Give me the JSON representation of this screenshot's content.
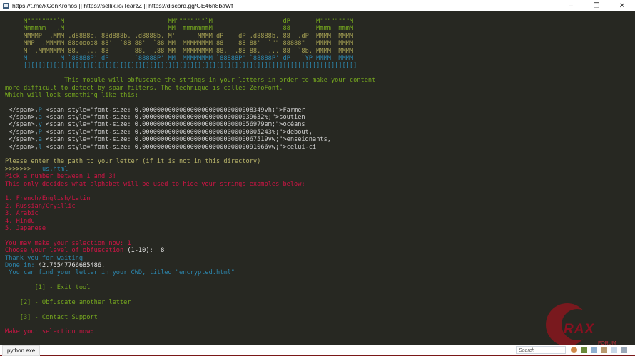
{
  "window": {
    "title": "https://t.me/xConKronos || https://sellix.io/TearzZ || https://discord.gg/GE46n8baWf",
    "minimize": "–",
    "restore": "❐",
    "close": "✕"
  },
  "terminal": {
    "lines": [
      [
        {
          "t": "     M\"\"\"\"\"\"\"\"`M                            MM\"\"\"\"\"\"\"\"`M                   dP       M\"\"\"\"\"\"\"\"M",
          "c": "green"
        }
      ],
      [
        {
          "t": "     Mmmmmm   .M                            MM  mmmmmmmM                   88       Mmmm  mmmM",
          "c": "green"
        }
      ],
      [
        {
          "t": "     MMMMP  .MMM .d8888b. 88d888b. .d8888b. M'      MMMM dP    dP .d8888b. 88  .dP  MMMM  MMMM",
          "c": "olive"
        }
      ],
      [
        {
          "t": "     MMP  .MMMMM 88ooood8 88'  `88 88'  `88 MM  MMMMMMMM 88    88 88'  `\"\" 88888\"   MMMM  MMMM",
          "c": "olive"
        }
      ],
      [
        {
          "t": "     M' .MMMMMMM 88.  ... 88       88.  .88 MM  MMMMMMMM 88.  .88 88.  ... 88  `8b. MMMM  MMMM",
          "c": "olive"
        }
      ],
      [
        {
          "t": "     M         M `88888P' dP       `88888P' MM  MMMMMMMM `88888P' `88888P' dP   `YP MMMM  MMMM",
          "c": "blue"
        }
      ],
      [
        {
          "t": "     [][][][][][][][][][][][][][][][][][][][][][][][][][][][][][][][][][][][][][][][][][][][][]",
          "c": "blue"
        }
      ],
      [],
      [
        {
          "t": "                This module will obfuscate the strings in your letters in order to make your content",
          "c": "green"
        }
      ],
      [
        {
          "t": "more difficult to detect by spam filters. The technique is called ZeroFont.",
          "c": "green"
        }
      ],
      [
        {
          "t": "Which will look something like this:",
          "c": "green"
        }
      ],
      [],
      [
        {
          "t": " </span>,",
          "c": "gray"
        },
        {
          "t": "P",
          "c": "blue"
        },
        {
          "t": " <span style=\"font-size: 0.000000000000000000000000000008349vh;\">Farmer",
          "c": "gray"
        }
      ],
      [
        {
          "t": " </span>,",
          "c": "gray"
        },
        {
          "t": "a",
          "c": "blue"
        },
        {
          "t": " <span style=\"font-size: 0.000000000000000000000000000039632%;\">soutien",
          "c": "gray"
        }
      ],
      [
        {
          "t": " </span>,",
          "c": "gray"
        },
        {
          "t": "y",
          "c": "blue"
        },
        {
          "t": " <span style=\"font-size: 0.000000000000000000000000000056979em;\">océans",
          "c": "gray"
        }
      ],
      [
        {
          "t": " </span>,",
          "c": "gray"
        },
        {
          "t": "P",
          "c": "blue"
        },
        {
          "t": " <span style=\"font-size: 0.00000000000000000000000000000005243%;\">debout,",
          "c": "gray"
        }
      ],
      [
        {
          "t": " </span>,",
          "c": "gray"
        },
        {
          "t": "a",
          "c": "blue"
        },
        {
          "t": " <span style=\"font-size: 0.0000000000000000000000000000067519vw;\">enseignants,",
          "c": "gray"
        }
      ],
      [
        {
          "t": " </span>,",
          "c": "gray"
        },
        {
          "t": "l",
          "c": "blue"
        },
        {
          "t": " <span style=\"font-size: 0.0000000000000000000000000000091066vw;\">celui-ci",
          "c": "gray"
        }
      ],
      [],
      [
        {
          "t": "Please enter the path to your letter (if it is not in this directory)",
          "c": "yellow"
        }
      ],
      [
        {
          "t": ">>>>>>>   ",
          "c": "yellow"
        },
        {
          "t": "us.html",
          "c": "blue"
        }
      ],
      [
        {
          "t": "Pick a number between 1 and 3!",
          "c": "red"
        }
      ],
      [
        {
          "t": "This only decides what alphabet will be used to hide your strings examples below:",
          "c": "red"
        }
      ],
      [],
      [
        {
          "t": "1. French/English/Latin",
          "c": "red"
        }
      ],
      [
        {
          "t": "2. Russian/Cryillic",
          "c": "red"
        }
      ],
      [
        {
          "t": "3. Arabic",
          "c": "red"
        }
      ],
      [
        {
          "t": "4. Hindu",
          "c": "red"
        }
      ],
      [
        {
          "t": "5. Japanese",
          "c": "red"
        }
      ],
      [],
      [
        {
          "t": "You may make your selection now: 1",
          "c": "red"
        }
      ],
      [
        {
          "t": "Choose your level of obfuscation ",
          "c": "red"
        },
        {
          "t": "(1-10):  8",
          "c": "white"
        }
      ],
      [
        {
          "t": "Thank you for waiting",
          "c": "blue"
        }
      ],
      [
        {
          "t": "Done in: ",
          "c": "blue"
        },
        {
          "t": "42.75547766685486.",
          "c": "white"
        }
      ],
      [
        {
          "t": " You can find your letter in your CWD, titled \"encrypted.html\"",
          "c": "blue"
        }
      ],
      [],
      [
        {
          "t": "        [1] - Exit tool",
          "c": "green"
        }
      ],
      [],
      [
        {
          "t": "    [2] - Obfuscate another letter",
          "c": "green"
        }
      ],
      [],
      [
        {
          "t": "    [3] - Contact Support",
          "c": "green"
        }
      ],
      [],
      [
        {
          "t": "Make your selection now: ",
          "c": "red"
        }
      ]
    ]
  },
  "taskbar": {
    "task_label": "python.exe",
    "search_placeholder": "Search"
  },
  "watermark": {
    "text": "RAX",
    "sub": "FORUM"
  },
  "colors": {
    "background": "#272822",
    "green": "#76a81f",
    "red": "#d01445",
    "blue": "#2c86ad"
  }
}
